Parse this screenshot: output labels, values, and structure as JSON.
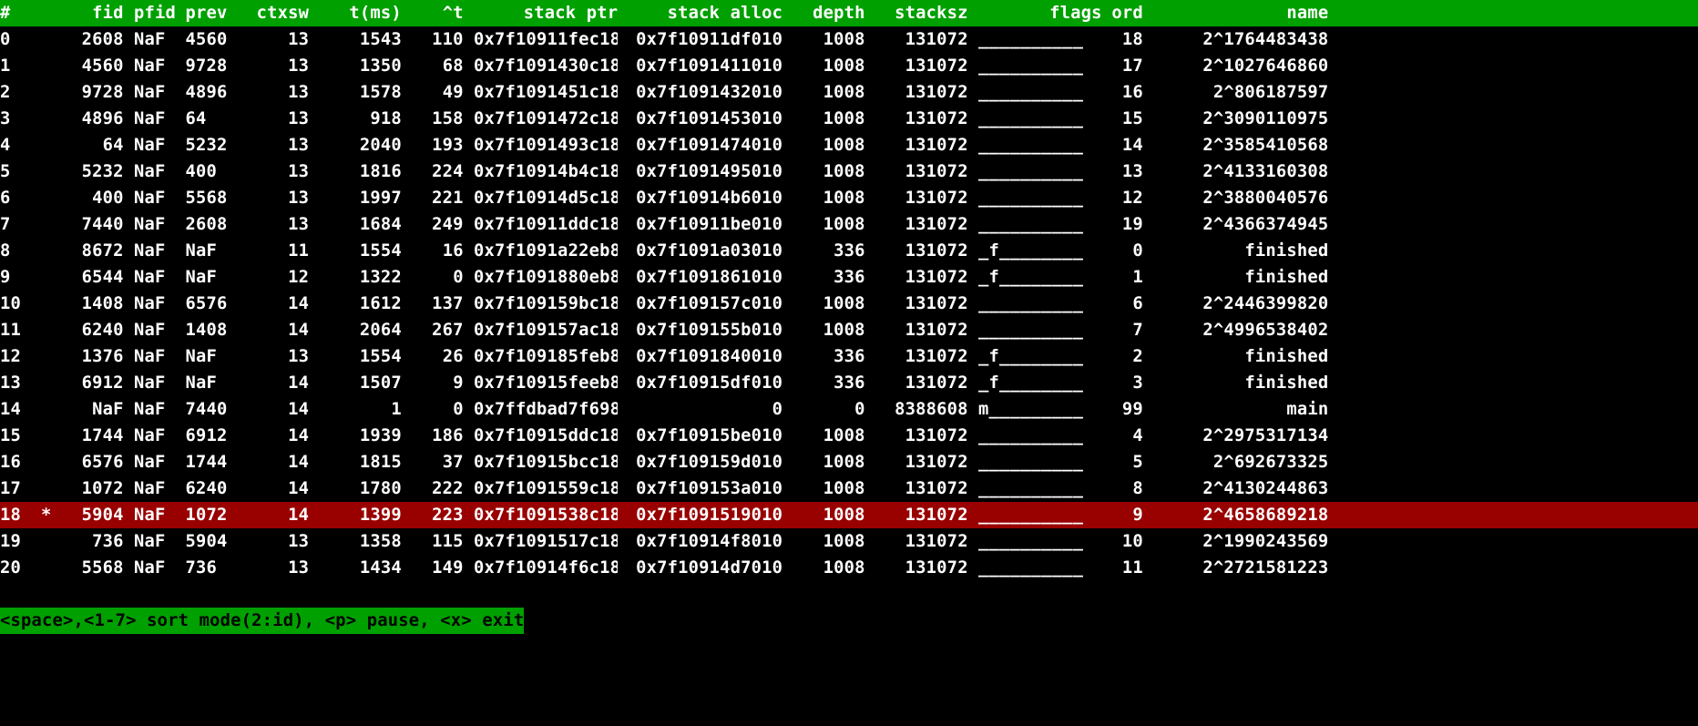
{
  "columns": {
    "idx": "#",
    "fid": "fid",
    "pfid": "pfid",
    "prev": "prev",
    "ctxsw": "ctxsw",
    "tms": "t(ms)",
    "tdelta": "^t",
    "sptr": "stack ptr",
    "salloc": "stack alloc",
    "depth": "depth",
    "stacksz": "stacksz",
    "flags": "flags",
    "ord": "ord",
    "name": "name"
  },
  "rows": [
    {
      "idx": "0",
      "mark": "",
      "fid": "2608",
      "pfid": "NaF",
      "prev": "4560",
      "ctxsw": "13",
      "tms": "1543",
      "tdelta": "110",
      "sptr": "0x7f10911fec18",
      "salloc": "0x7f10911df010",
      "depth": "1008",
      "stacksz": "131072",
      "flags": "__________",
      "ord": "18",
      "name": "2^1764483438"
    },
    {
      "idx": "1",
      "mark": "",
      "fid": "4560",
      "pfid": "NaF",
      "prev": "9728",
      "ctxsw": "13",
      "tms": "1350",
      "tdelta": "68",
      "sptr": "0x7f1091430c18",
      "salloc": "0x7f1091411010",
      "depth": "1008",
      "stacksz": "131072",
      "flags": "__________",
      "ord": "17",
      "name": "2^1027646860"
    },
    {
      "idx": "2",
      "mark": "",
      "fid": "9728",
      "pfid": "NaF",
      "prev": "4896",
      "ctxsw": "13",
      "tms": "1578",
      "tdelta": "49",
      "sptr": "0x7f1091451c18",
      "salloc": "0x7f1091432010",
      "depth": "1008",
      "stacksz": "131072",
      "flags": "__________",
      "ord": "16",
      "name": "2^806187597"
    },
    {
      "idx": "3",
      "mark": "",
      "fid": "4896",
      "pfid": "NaF",
      "prev": "64",
      "ctxsw": "13",
      "tms": "918",
      "tdelta": "158",
      "sptr": "0x7f1091472c18",
      "salloc": "0x7f1091453010",
      "depth": "1008",
      "stacksz": "131072",
      "flags": "__________",
      "ord": "15",
      "name": "2^3090110975"
    },
    {
      "idx": "4",
      "mark": "",
      "fid": "64",
      "pfid": "NaF",
      "prev": "5232",
      "ctxsw": "13",
      "tms": "2040",
      "tdelta": "193",
      "sptr": "0x7f1091493c18",
      "salloc": "0x7f1091474010",
      "depth": "1008",
      "stacksz": "131072",
      "flags": "__________",
      "ord": "14",
      "name": "2^3585410568"
    },
    {
      "idx": "5",
      "mark": "",
      "fid": "5232",
      "pfid": "NaF",
      "prev": "400",
      "ctxsw": "13",
      "tms": "1816",
      "tdelta": "224",
      "sptr": "0x7f10914b4c18",
      "salloc": "0x7f1091495010",
      "depth": "1008",
      "stacksz": "131072",
      "flags": "__________",
      "ord": "13",
      "name": "2^4133160308"
    },
    {
      "idx": "6",
      "mark": "",
      "fid": "400",
      "pfid": "NaF",
      "prev": "5568",
      "ctxsw": "13",
      "tms": "1997",
      "tdelta": "221",
      "sptr": "0x7f10914d5c18",
      "salloc": "0x7f10914b6010",
      "depth": "1008",
      "stacksz": "131072",
      "flags": "__________",
      "ord": "12",
      "name": "2^3880040576"
    },
    {
      "idx": "7",
      "mark": "",
      "fid": "7440",
      "pfid": "NaF",
      "prev": "2608",
      "ctxsw": "13",
      "tms": "1684",
      "tdelta": "249",
      "sptr": "0x7f10911ddc18",
      "salloc": "0x7f10911be010",
      "depth": "1008",
      "stacksz": "131072",
      "flags": "__________",
      "ord": "19",
      "name": "2^4366374945"
    },
    {
      "idx": "8",
      "mark": "",
      "fid": "8672",
      "pfid": "NaF",
      "prev": "NaF",
      "ctxsw": "11",
      "tms": "1554",
      "tdelta": "16",
      "sptr": "0x7f1091a22eb8",
      "salloc": "0x7f1091a03010",
      "depth": "336",
      "stacksz": "131072",
      "flags": "_f________",
      "ord": "0",
      "name": "finished"
    },
    {
      "idx": "9",
      "mark": "",
      "fid": "6544",
      "pfid": "NaF",
      "prev": "NaF",
      "ctxsw": "12",
      "tms": "1322",
      "tdelta": "0",
      "sptr": "0x7f1091880eb8",
      "salloc": "0x7f1091861010",
      "depth": "336",
      "stacksz": "131072",
      "flags": "_f________",
      "ord": "1",
      "name": "finished"
    },
    {
      "idx": "10",
      "mark": "",
      "fid": "1408",
      "pfid": "NaF",
      "prev": "6576",
      "ctxsw": "14",
      "tms": "1612",
      "tdelta": "137",
      "sptr": "0x7f109159bc18",
      "salloc": "0x7f109157c010",
      "depth": "1008",
      "stacksz": "131072",
      "flags": "__________",
      "ord": "6",
      "name": "2^2446399820"
    },
    {
      "idx": "11",
      "mark": "",
      "fid": "6240",
      "pfid": "NaF",
      "prev": "1408",
      "ctxsw": "14",
      "tms": "2064",
      "tdelta": "267",
      "sptr": "0x7f109157ac18",
      "salloc": "0x7f109155b010",
      "depth": "1008",
      "stacksz": "131072",
      "flags": "__________",
      "ord": "7",
      "name": "2^4996538402"
    },
    {
      "idx": "12",
      "mark": "",
      "fid": "1376",
      "pfid": "NaF",
      "prev": "NaF",
      "ctxsw": "13",
      "tms": "1554",
      "tdelta": "26",
      "sptr": "0x7f109185feb8",
      "salloc": "0x7f1091840010",
      "depth": "336",
      "stacksz": "131072",
      "flags": "_f________",
      "ord": "2",
      "name": "finished"
    },
    {
      "idx": "13",
      "mark": "",
      "fid": "6912",
      "pfid": "NaF",
      "prev": "NaF",
      "ctxsw": "14",
      "tms": "1507",
      "tdelta": "9",
      "sptr": "0x7f10915feeb8",
      "salloc": "0x7f10915df010",
      "depth": "336",
      "stacksz": "131072",
      "flags": "_f________",
      "ord": "3",
      "name": "finished"
    },
    {
      "idx": "14",
      "mark": "",
      "fid": "NaF",
      "pfid": "NaF",
      "prev": "7440",
      "ctxsw": "14",
      "tms": "1",
      "tdelta": "0",
      "sptr": "0x7ffdbad7f698",
      "salloc": "0",
      "depth": "0",
      "stacksz": "8388608",
      "flags": "m_________",
      "ord": "99",
      "name": "main"
    },
    {
      "idx": "15",
      "mark": "",
      "fid": "1744",
      "pfid": "NaF",
      "prev": "6912",
      "ctxsw": "14",
      "tms": "1939",
      "tdelta": "186",
      "sptr": "0x7f10915ddc18",
      "salloc": "0x7f10915be010",
      "depth": "1008",
      "stacksz": "131072",
      "flags": "__________",
      "ord": "4",
      "name": "2^2975317134"
    },
    {
      "idx": "16",
      "mark": "",
      "fid": "6576",
      "pfid": "NaF",
      "prev": "1744",
      "ctxsw": "14",
      "tms": "1815",
      "tdelta": "37",
      "sptr": "0x7f10915bcc18",
      "salloc": "0x7f109159d010",
      "depth": "1008",
      "stacksz": "131072",
      "flags": "__________",
      "ord": "5",
      "name": "2^692673325"
    },
    {
      "idx": "17",
      "mark": "",
      "fid": "1072",
      "pfid": "NaF",
      "prev": "6240",
      "ctxsw": "14",
      "tms": "1780",
      "tdelta": "222",
      "sptr": "0x7f1091559c18",
      "salloc": "0x7f109153a010",
      "depth": "1008",
      "stacksz": "131072",
      "flags": "__________",
      "ord": "8",
      "name": "2^4130244863"
    },
    {
      "idx": "18",
      "mark": "*",
      "fid": "5904",
      "pfid": "NaF",
      "prev": "1072",
      "ctxsw": "14",
      "tms": "1399",
      "tdelta": "223",
      "sptr": "0x7f1091538c18",
      "salloc": "0x7f1091519010",
      "depth": "1008",
      "stacksz": "131072",
      "flags": "__________",
      "ord": "9",
      "name": "2^4658689218",
      "selected": true
    },
    {
      "idx": "19",
      "mark": "",
      "fid": "736",
      "pfid": "NaF",
      "prev": "5904",
      "ctxsw": "13",
      "tms": "1358",
      "tdelta": "115",
      "sptr": "0x7f1091517c18",
      "salloc": "0x7f10914f8010",
      "depth": "1008",
      "stacksz": "131072",
      "flags": "__________",
      "ord": "10",
      "name": "2^1990243569"
    },
    {
      "idx": "20",
      "mark": "",
      "fid": "5568",
      "pfid": "NaF",
      "prev": "736",
      "ctxsw": "13",
      "tms": "1434",
      "tdelta": "149",
      "sptr": "0x7f10914f6c18",
      "salloc": "0x7f10914d7010",
      "depth": "1008",
      "stacksz": "131072",
      "flags": "__________",
      "ord": "11",
      "name": "2^2721581223"
    }
  ],
  "footer": "<space>,<1-7> sort mode(2:id), <p> pause, <x> exit"
}
